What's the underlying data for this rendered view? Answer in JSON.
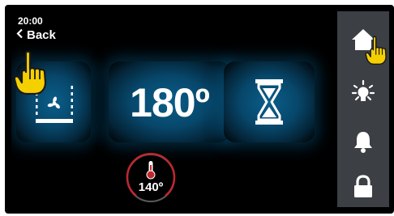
{
  "status": {
    "time": "20:00"
  },
  "nav": {
    "back_label": "Back"
  },
  "cooking": {
    "mode_icon": "fan-icon",
    "temperature_setpoint": "180º",
    "timer_icon": "hourglass-icon",
    "current_temperature": "140º"
  },
  "side_rail": {
    "items": [
      "home-icon",
      "light-icon",
      "bell-icon",
      "lock-icon"
    ]
  },
  "colors": {
    "tile_glow": "#0a5e8a",
    "rail_bg": "#3c3f44",
    "dial_ring": "#c0282d",
    "thermometer": "#c0282d",
    "pointer_hand": "#f5d000"
  }
}
